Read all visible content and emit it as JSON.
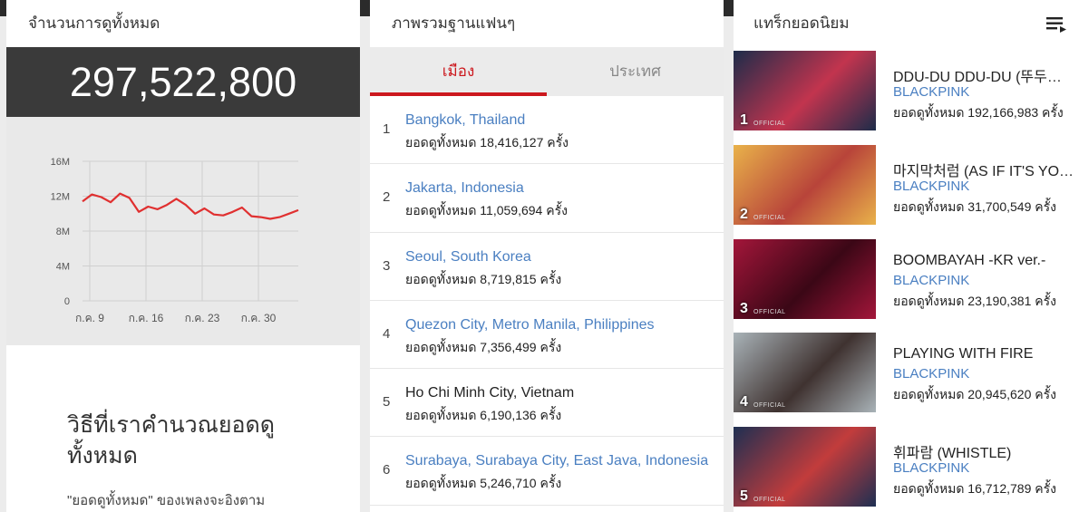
{
  "total_views": {
    "title": "จำนวนการดูทั้งหมด",
    "value": "297,522,800",
    "how_title": "วิธีที่เราคำนวณยอดดูทั้งหมด",
    "how_body": "\"ยอดดูทั้งหมด\" ของเพลงจะอิงตาม"
  },
  "chart_data": {
    "type": "line",
    "x_tick_labels": [
      "ก.ค. 9",
      "ก.ค. 16",
      "ก.ค. 23",
      "ก.ค. 30"
    ],
    "y_tick_labels": [
      "16M",
      "12M",
      "8M",
      "4M",
      "0"
    ],
    "ylim": [
      0,
      16000000
    ],
    "grid": true,
    "color": "#e03030",
    "series": [
      {
        "values": [
          11400000,
          12200000,
          11900000,
          11300000,
          12300000,
          11800000,
          10200000,
          10800000,
          10500000,
          11000000,
          11700000,
          11000000,
          10000000,
          10600000,
          9900000,
          9800000,
          10200000,
          10700000,
          9700000,
          9600000,
          9400000,
          9600000,
          10000000,
          10400000
        ]
      }
    ]
  },
  "fan_base": {
    "title": "ภาพรวมฐานแฟนๆ",
    "tabs": [
      {
        "label": "เมือง",
        "active": true
      },
      {
        "label": "ประเทศ",
        "active": false
      }
    ],
    "cities": [
      {
        "rank": "1",
        "name": "Bangkok, Thailand",
        "views": "ยอดดูทั้งหมด 18,416,127 ครั้ง",
        "link": true
      },
      {
        "rank": "2",
        "name": "Jakarta, Indonesia",
        "views": "ยอดดูทั้งหมด 11,059,694 ครั้ง",
        "link": true
      },
      {
        "rank": "3",
        "name": "Seoul, South Korea",
        "views": "ยอดดูทั้งหมด 8,719,815 ครั้ง",
        "link": true
      },
      {
        "rank": "4",
        "name": "Quezon City, Metro Manila, Philippines",
        "views": "ยอดดูทั้งหมด 7,356,499 ครั้ง",
        "link": true
      },
      {
        "rank": "5",
        "name": "Ho Chi Minh City, Vietnam",
        "views": "ยอดดูทั้งหมด 6,190,136 ครั้ง",
        "link": false
      },
      {
        "rank": "6",
        "name": "Surabaya, Surabaya City, East Java, Indonesia",
        "views": "ยอดดูทั้งหมด 5,246,710 ครั้ง",
        "link": true
      }
    ]
  },
  "popular_tracks": {
    "title": "แทร็กยอดนิยม",
    "icon": "playlist-icon",
    "thumb_logo": "OFFICIAL",
    "tracks": [
      {
        "rank": "1",
        "title": "DDU-DU DDU-DU (뚜두뚜두)",
        "artist": "BLACKPINK",
        "views": "ยอดดูทั้งหมด 192,166,983 ครั้ง",
        "bg": "#1d2c4a",
        "accent": "#c2344e"
      },
      {
        "rank": "2",
        "title": "마지막처럼 (AS IF IT'S YOUR LAST)",
        "artist": "BLACKPINK",
        "views": "ยอดดูทั้งหมด 31,700,549 ครั้ง",
        "bg": "#e9b24a",
        "accent": "#b8443a"
      },
      {
        "rank": "3",
        "title": "BOOMBAYAH -KR ver.-",
        "artist": "BLACKPINK",
        "views": "ยอดดูทั้งหมด 23,190,381 ครั้ง",
        "bg": "#a3163a",
        "accent": "#3b0716"
      },
      {
        "rank": "4",
        "title": "PLAYING WITH FIRE",
        "artist": "BLACKPINK",
        "views": "ยอดดูทั้งหมด 20,945,620 ครั้ง",
        "bg": "#a9b3b8",
        "accent": "#3f3230"
      },
      {
        "rank": "5",
        "title": "휘파람 (WHISTLE)",
        "artist": "BLACKPINK",
        "views": "ยอดดูทั้งหมด 16,712,789 ครั้ง",
        "bg": "#1e2f52",
        "accent": "#c23c3c"
      }
    ]
  }
}
